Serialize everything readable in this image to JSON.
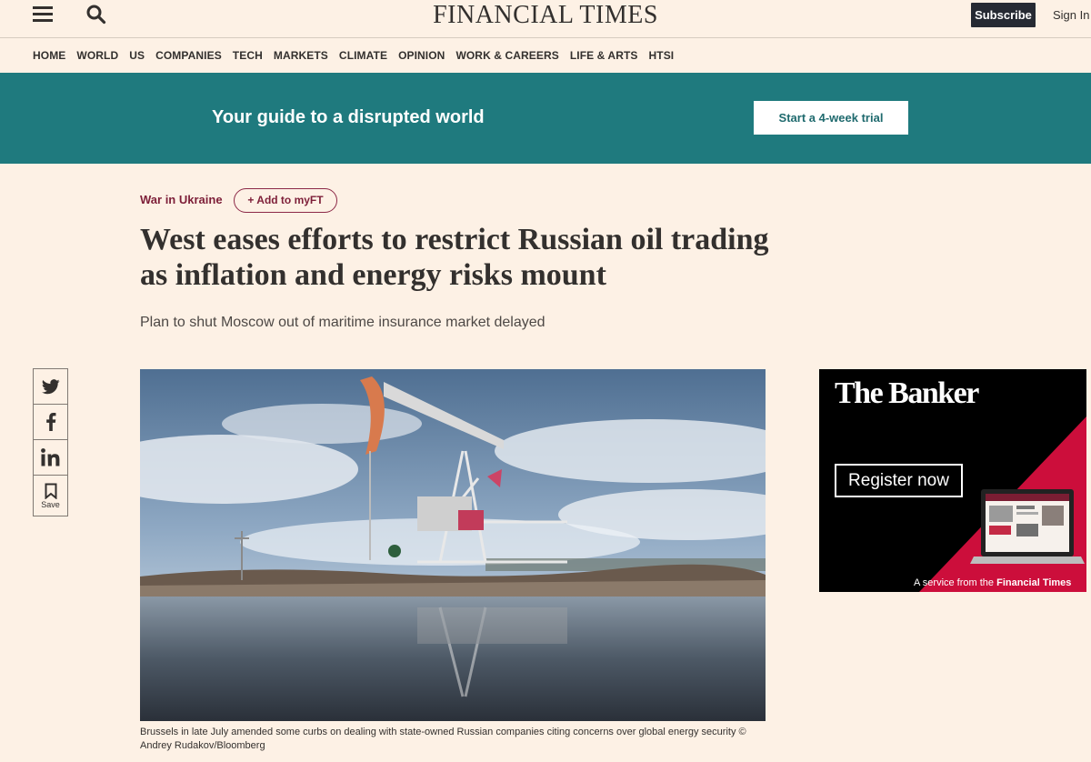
{
  "header": {
    "logo": "FINANCIAL TIMES",
    "subscribe_label": "Subscribe",
    "signin_label": "Sign In"
  },
  "nav": {
    "items": [
      "HOME",
      "WORLD",
      "US",
      "COMPANIES",
      "TECH",
      "MARKETS",
      "CLIMATE",
      "OPINION",
      "WORK & CAREERS",
      "LIFE & ARTS",
      "HTSI"
    ]
  },
  "promo": {
    "text": "Your guide to a disrupted world",
    "button_label": "Start a 4-week trial"
  },
  "article": {
    "topic": "War in Ukraine",
    "myft_label": "+ Add to myFT",
    "headline": "West eases efforts to restrict Russian oil trading as inflation and energy risks mount",
    "standfirst": "Plan to shut Moscow out of maritime insurance market delayed",
    "caption": "Brussels in late July amended some curbs on dealing with state-owned Russian companies citing concerns over global energy security © Andrey Rudakov/Bloomberg"
  },
  "share": {
    "save_label": "Save",
    "icons": [
      "twitter-icon",
      "facebook-icon",
      "linkedin-icon",
      "bookmark-icon"
    ]
  },
  "ad": {
    "title": "The Banker",
    "button_label": "Register now",
    "footer_prefix": "A service from the ",
    "footer_brand": "Financial Times"
  },
  "colors": {
    "page_bg": "#fdf1e5",
    "promo_bg": "#1f7a7e",
    "topic": "#7d1e38",
    "subscribe_bg": "#262a33",
    "ad_accent": "#cc0e3b"
  }
}
